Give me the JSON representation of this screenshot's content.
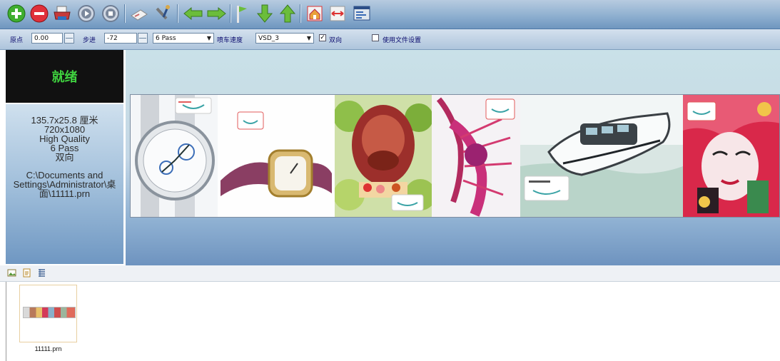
{
  "toolbar": {
    "icons": [
      "add-icon",
      "remove-icon",
      "print-icon",
      "play-icon",
      "stop-icon",
      "clean-icon",
      "tools-icon",
      "arrow-left-icon",
      "arrow-right-icon",
      "flag-icon",
      "arrow-down-icon",
      "arrow-up-icon",
      "home-icon",
      "measure-icon",
      "settings-icon"
    ]
  },
  "params": {
    "origin_label": "原点",
    "origin_value": "0.00",
    "step_label": "步进",
    "step_value": "-72",
    "pass_value": "6 Pass",
    "speed_label": "喷车速度",
    "speed_value": "VSD_3",
    "bidirectional_label": "双向",
    "bidirectional_checked": true,
    "use_file_settings_label": "使用文件设置",
    "use_file_settings_checked": false
  },
  "status": {
    "state": "就绪",
    "size": "135.7x25.8 厘米",
    "resolution": "720x1080",
    "quality": "High Quality",
    "pass": "6 Pass",
    "direction": "双向",
    "path_line1": "C:\\Documents and",
    "path_line2": "Settings\\Administrator\\桌",
    "path_line3": "面\\11111.prn"
  },
  "preview": {
    "images": [
      "watch-1",
      "watch-2",
      "lobster-dish",
      "lobster",
      "speedboat",
      "opera-mask"
    ]
  },
  "filelist": {
    "toolbar_icons": [
      "image-view-icon",
      "file-icon",
      "list-view-icon"
    ],
    "files": [
      {
        "name": "11111.prn"
      }
    ]
  },
  "colors": {
    "status_text": "#3fd13f",
    "toolbar_blue": "#6f96bf",
    "panel_blue": "#9dbcd9"
  }
}
